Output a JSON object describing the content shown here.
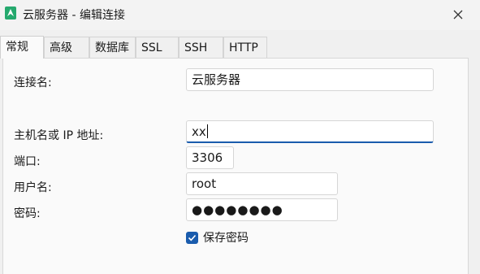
{
  "window": {
    "title": "云服务器 - 编辑连接",
    "app_icon": "navicat-icon",
    "close_icon": "close-icon"
  },
  "tabs": [
    {
      "label": "常规",
      "active": true
    },
    {
      "label": "高级",
      "active": false
    },
    {
      "label": "数据库",
      "active": false
    },
    {
      "label": "SSL",
      "active": false
    },
    {
      "label": "SSH",
      "active": false
    },
    {
      "label": "HTTP",
      "active": false
    }
  ],
  "form": {
    "connection_name": {
      "label": "连接名:",
      "value": "云服务器"
    },
    "host": {
      "label": "主机名或 IP 地址:",
      "value": "xx"
    },
    "port": {
      "label": "端口:",
      "value": "3306"
    },
    "username": {
      "label": "用户名:",
      "value": "root"
    },
    "password": {
      "label": "密码:",
      "value": "●●●●●●●●"
    },
    "save_password": {
      "label": "保存密码",
      "checked": true
    }
  },
  "colors": {
    "accent": "#1a5cad",
    "app_icon": "#25a96e"
  }
}
